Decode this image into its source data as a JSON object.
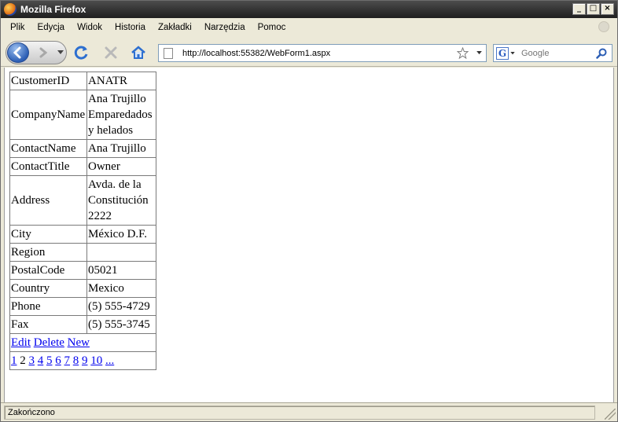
{
  "window": {
    "title": "Mozilla Firefox",
    "controls": [
      "_",
      "□",
      "×"
    ]
  },
  "menu": {
    "items": [
      "Plik",
      "Edycja",
      "Widok",
      "Historia",
      "Zakładki",
      "Narzędzia",
      "Pomoc"
    ]
  },
  "toolbar": {
    "url": "http://localhost:55382/WebForm1.aspx",
    "search_placeholder": "Google",
    "icons": [
      "back-icon",
      "forward-icon",
      "reload-icon",
      "stop-icon",
      "home-icon",
      "bookmark-star-icon",
      "search-magnifier-icon"
    ]
  },
  "details": {
    "rows": [
      {
        "field": "CustomerID",
        "value": "ANATR"
      },
      {
        "field": "CompanyName",
        "value": "Ana Trujillo Emparedados y helados"
      },
      {
        "field": "ContactName",
        "value": "Ana Trujillo"
      },
      {
        "field": "ContactTitle",
        "value": "Owner"
      },
      {
        "field": "Address",
        "value": "Avda. de la Constitución 2222"
      },
      {
        "field": "City",
        "value": "México D.F."
      },
      {
        "field": "Region",
        "value": ""
      },
      {
        "field": "PostalCode",
        "value": "05021"
      },
      {
        "field": "Country",
        "value": "Mexico"
      },
      {
        "field": "Phone",
        "value": "(5) 555-4729"
      },
      {
        "field": "Fax",
        "value": "(5) 555-3745"
      }
    ],
    "commands": [
      "Edit",
      "Delete",
      "New"
    ],
    "pager": [
      "1",
      "2",
      "3",
      "4",
      "5",
      "6",
      "7",
      "8",
      "9",
      "10",
      "..."
    ],
    "current_page": "2"
  },
  "status": {
    "text": "Zakończono"
  }
}
